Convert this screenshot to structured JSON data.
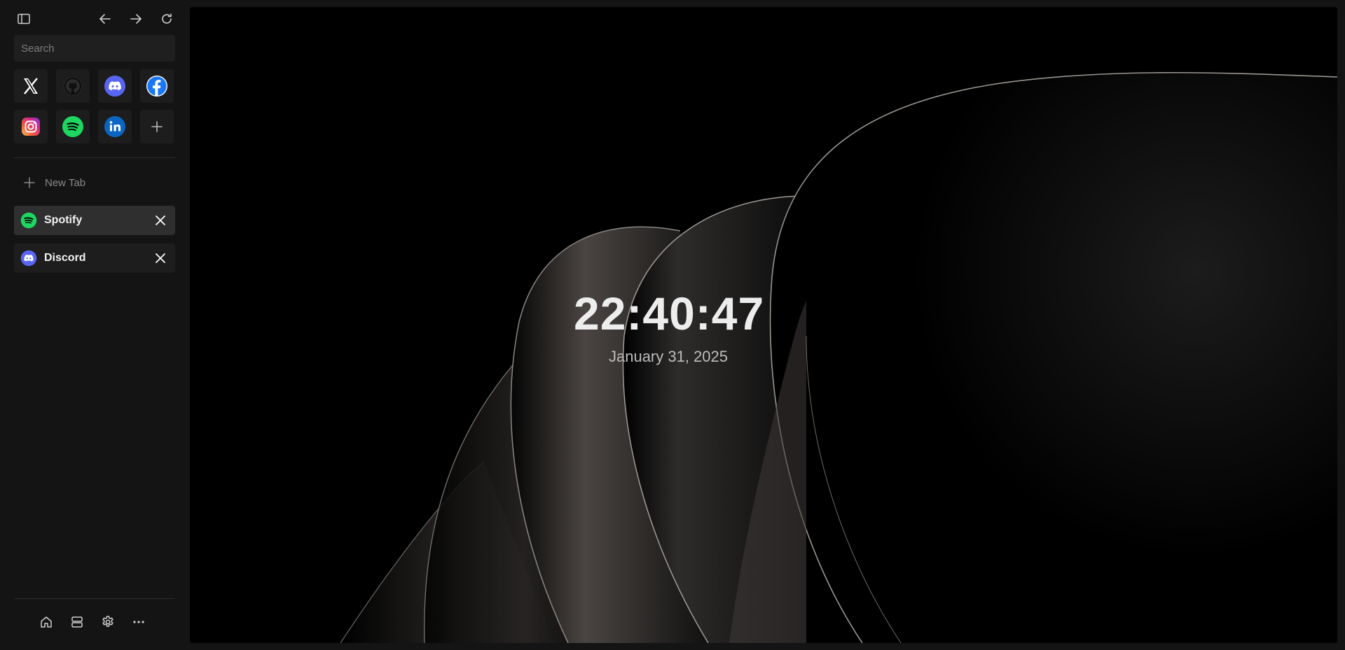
{
  "sidebar": {
    "toolbar": {
      "toggle_icon": "sidebar-toggle-icon",
      "back_icon": "arrow-left-icon",
      "forward_icon": "arrow-right-icon",
      "reload_icon": "reload-icon"
    },
    "search": {
      "placeholder": "Search",
      "value": ""
    },
    "quick_links": [
      {
        "name": "X",
        "icon": "x-icon"
      },
      {
        "name": "GitHub",
        "icon": "github-icon"
      },
      {
        "name": "Discord",
        "icon": "discord-icon"
      },
      {
        "name": "Facebook",
        "icon": "facebook-icon"
      },
      {
        "name": "Instagram",
        "icon": "instagram-icon"
      },
      {
        "name": "Spotify",
        "icon": "spotify-icon"
      },
      {
        "name": "LinkedIn",
        "icon": "linkedin-icon"
      },
      {
        "name": "Add",
        "icon": "plus-icon"
      }
    ],
    "new_tab_label": "New Tab",
    "tabs": [
      {
        "title": "Spotify",
        "icon": "spotify-icon",
        "active": true
      },
      {
        "title": "Discord",
        "icon": "discord-icon",
        "active": false
      }
    ],
    "bottom_icons": [
      "home-icon",
      "layout-icon",
      "settings-icon",
      "more-icon"
    ]
  },
  "main": {
    "time": "22:40:47",
    "date": "January 31, 2025"
  },
  "colors": {
    "spotify": "#1ed760",
    "discord": "#5865f2",
    "facebook": "#1877f2",
    "linkedin": "#0a66c2",
    "sidebar_bg": "#141414",
    "active_tab_bg": "#2f2f2f"
  }
}
